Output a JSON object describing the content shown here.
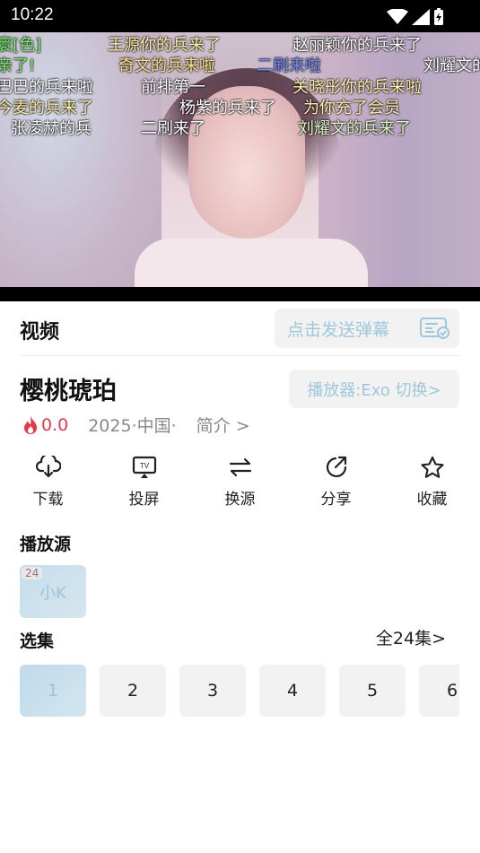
{
  "status": {
    "time": "10:22"
  },
  "danmaku": [
    {
      "text": "寰[色]",
      "color": "#7bf06f"
    },
    {
      "text": "王源你的兵来了",
      "color": "#fff1a8"
    },
    {
      "text": "赵丽颖你的兵来了",
      "color": "#ffffff"
    },
    {
      "text": "亲了!",
      "color": "#7bf06f"
    },
    {
      "text": "奇文的兵来啦",
      "color": "#ffe08a"
    },
    {
      "text": "二刷来啦",
      "color": "#7b8bff"
    },
    {
      "text": "刘耀文的",
      "color": "#ffffff"
    },
    {
      "text": "巴巴的兵来啦",
      "color": "#ffffff"
    },
    {
      "text": "前排第一",
      "color": "#ffffff"
    },
    {
      "text": "关晓彤你的兵来啦",
      "color": "#fff1a8"
    },
    {
      "text": "今麦的兵来了",
      "color": "#fff1a8"
    },
    {
      "text": "杨紫的兵来了",
      "color": "#ffffff"
    },
    {
      "text": "为你充了会员",
      "color": "#fff1a8"
    },
    {
      "text": "张凌赫的兵",
      "color": "#ffffff"
    },
    {
      "text": "二刷来了",
      "color": "#ffffff"
    },
    {
      "text": "刘耀文的兵来了",
      "color": "#dff7c4"
    }
  ],
  "tab": {
    "video": "视频"
  },
  "send_danmaku": {
    "label": "点击发送弹幕"
  },
  "video": {
    "title": "樱桃琥珀",
    "player_switch": "播放器:Exo 切换>",
    "score": "0.0",
    "year_region": "2025·中国·",
    "intro": "简介 >"
  },
  "actions": [
    {
      "label": "下载",
      "icon": "download-icon"
    },
    {
      "label": "投屏",
      "icon": "tv-cast-icon"
    },
    {
      "label": "换源",
      "icon": "switch-source-icon"
    },
    {
      "label": "分享",
      "icon": "share-icon"
    },
    {
      "label": "收藏",
      "icon": "star-icon"
    }
  ],
  "sources": {
    "label": "播放源",
    "items": [
      {
        "name": "小K",
        "count": "24"
      }
    ]
  },
  "episodes": {
    "label": "选集",
    "all": "全24集>",
    "items": [
      "1",
      "2",
      "3",
      "4",
      "5",
      "6"
    ],
    "active": "1"
  },
  "colors": {
    "accent": "#9fc7dc",
    "score": "#e23a4b"
  }
}
